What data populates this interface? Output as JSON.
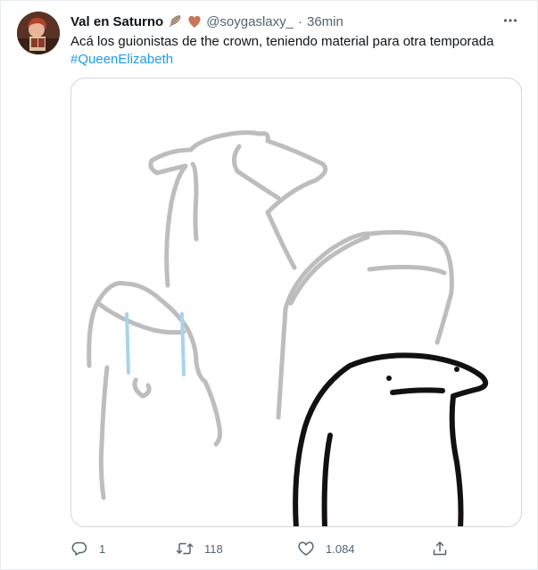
{
  "tweet": {
    "author": {
      "display_name": "Val en Saturno",
      "handle": "@soygaslaxy_",
      "name_emojis": [
        "feather-emoji",
        "heart-emoji"
      ]
    },
    "separator": "·",
    "time": "36min",
    "text": "Acá los guionistas de the crown, teniendo material para otra temporada",
    "hashtag": "#QueenElizabeth"
  },
  "actions": {
    "reply": {
      "icon": "reply-icon",
      "count": "1"
    },
    "retweet": {
      "icon": "retweet-icon",
      "count": "118"
    },
    "like": {
      "icon": "heart-icon",
      "count": "1.084"
    },
    "share": {
      "icon": "share-icon"
    }
  },
  "colors": {
    "text": "#0f1419",
    "secondary": "#536471",
    "link": "#1d9bf0",
    "border": "#cfd9de",
    "heart_emoji": "#c8775a"
  }
}
